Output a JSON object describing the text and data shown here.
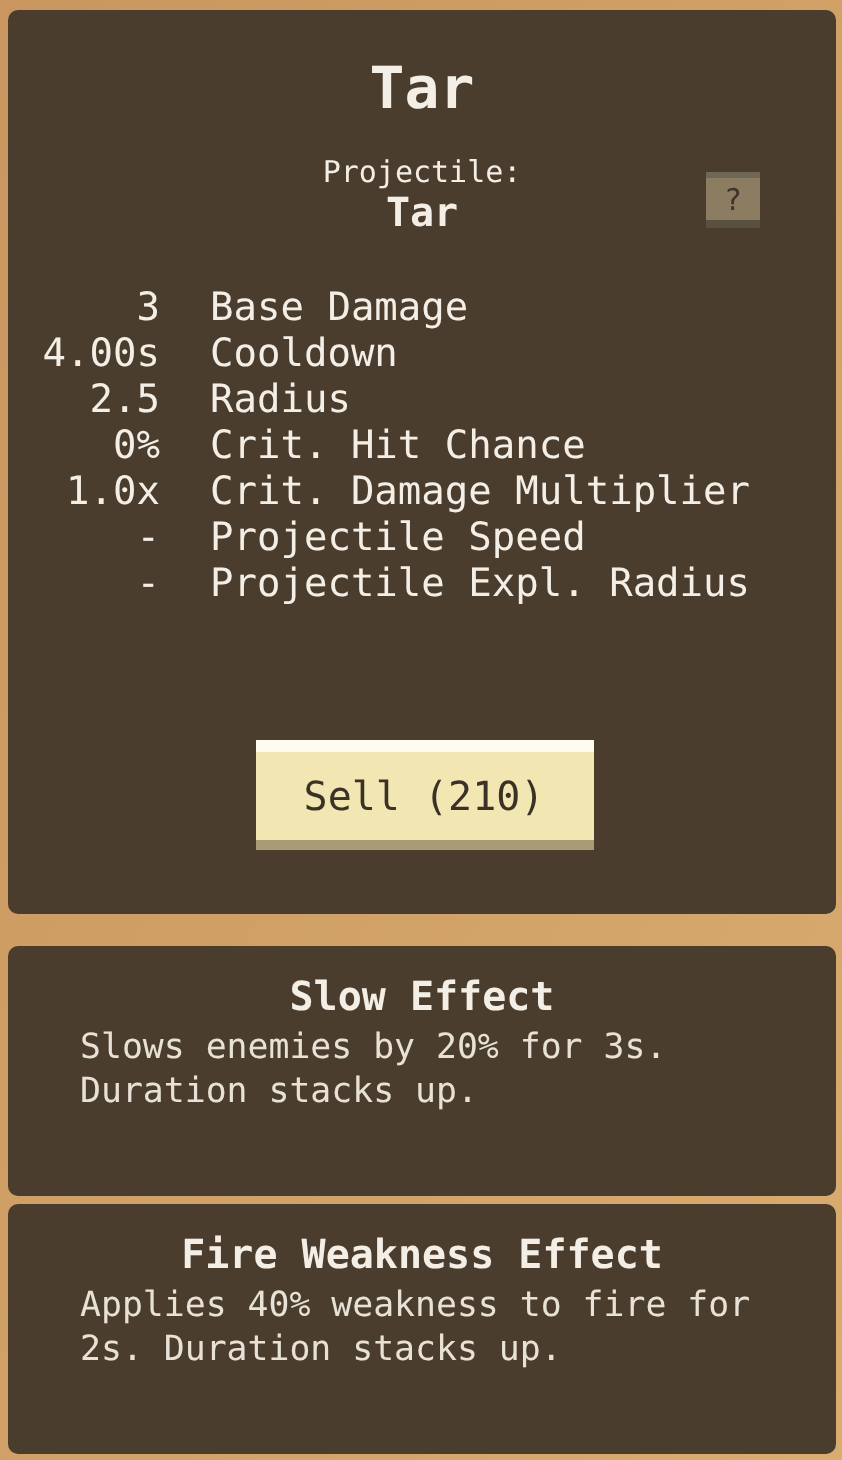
{
  "tower": {
    "title": "Tar",
    "projectile_label": "Projectile:",
    "projectile_name": "Tar",
    "help_button": "?",
    "stats": [
      {
        "value": "3",
        "label": "Base Damage"
      },
      {
        "value": "4.00s",
        "label": "Cooldown"
      },
      {
        "value": "2.5",
        "label": "Radius"
      },
      {
        "value": "0%",
        "label": "Crit. Hit Chance"
      },
      {
        "value": "1.0x",
        "label": "Crit. Damage Multiplier"
      },
      {
        "value": "-",
        "label": "Projectile Speed"
      },
      {
        "value": "-",
        "label": "Projectile Expl. Radius"
      }
    ],
    "sell_button": "Sell (210)"
  },
  "effects": [
    {
      "title": "Slow Effect",
      "description": "Slows enemies by 20% for 3s. Duration stacks up."
    },
    {
      "title": "Fire Weakness Effect",
      "description": "Applies 40% weakness to fire for 2s. Duration stacks up."
    }
  ]
}
